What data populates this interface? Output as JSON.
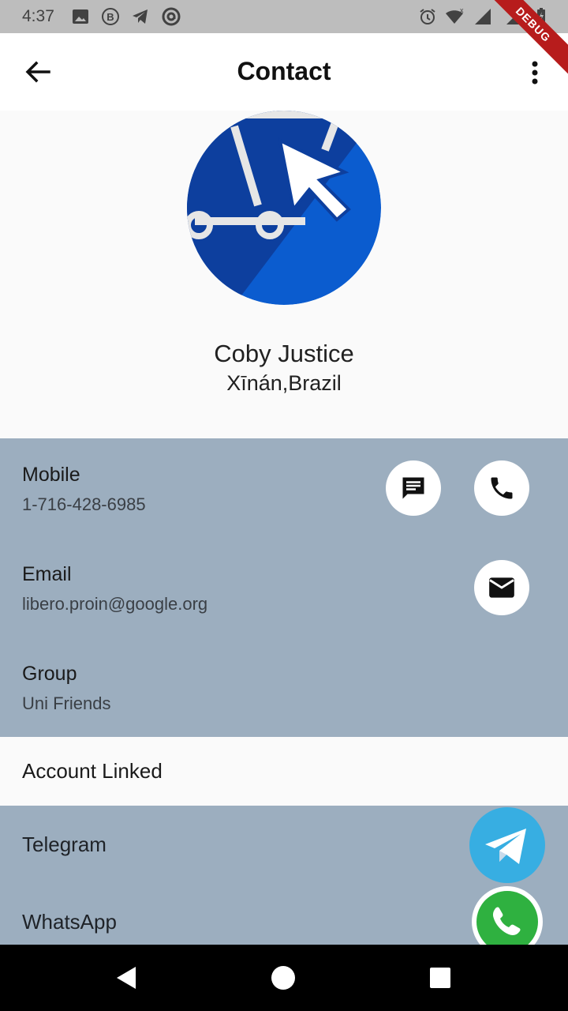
{
  "status_bar": {
    "time": "4:37",
    "left_icons": [
      "image-icon",
      "b-notification-icon",
      "telegram-notification-icon",
      "at-sign-icon"
    ],
    "right_icons": [
      "alarm-icon",
      "wifi-icon",
      "signal-icon",
      "battery-icon"
    ]
  },
  "debug_banner": "DEBUG",
  "app_bar": {
    "title": "Contact",
    "back_icon": "arrow-back-icon",
    "menu_icon": "more-vert-icon"
  },
  "profile": {
    "name": "Coby Justice",
    "location": "Xīnán,Brazil"
  },
  "info": {
    "mobile_label": "Mobile",
    "mobile_value": "1-716-428-6985",
    "email_label": "Email",
    "email_value": "libero.proin@google.org",
    "group_label": "Group",
    "group_value": "Uni Friends"
  },
  "accounts": {
    "header": "Account Linked",
    "items": [
      {
        "label": "Telegram",
        "icon": "telegram-logo-icon"
      },
      {
        "label": "WhatsApp",
        "icon": "whatsapp-logo-icon"
      }
    ]
  },
  "colors": {
    "info_panel": "#9caebf",
    "app_bar": "#ffffff",
    "background": "#fafafa",
    "telegram": "#37aee2",
    "whatsapp": "#2fb140"
  }
}
